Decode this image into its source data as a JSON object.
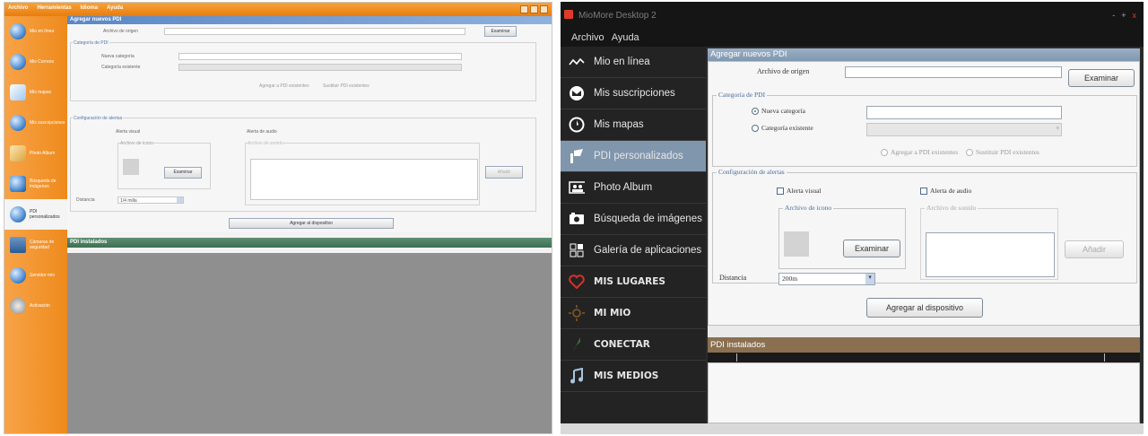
{
  "left": {
    "menu": [
      "Archivo",
      "Herramientas",
      "Idioma",
      "Ayuda"
    ],
    "sidebar": [
      {
        "label": "Mio en línea",
        "active": false
      },
      {
        "label": "Mis Correos",
        "active": false
      },
      {
        "label": "Mis mapas",
        "active": false
      },
      {
        "label": "Mis suscripciones",
        "active": false
      },
      {
        "label": "Photo Album",
        "active": false
      },
      {
        "label": "Búsqueda de imágenes",
        "active": false
      },
      {
        "label": "PDI personalizados",
        "active": true
      },
      {
        "label": "Cámaras de seguridad",
        "active": false
      },
      {
        "label": "Servidor mio",
        "active": false
      },
      {
        "label": "Activación",
        "active": false
      }
    ],
    "panel_title": "Agregar nuevos PDI",
    "source_file_label": "Archivo de origen",
    "browse_label": "Examinar",
    "category_group": "Categoría de PDI",
    "new_category": "Nueva categoría",
    "existing_category": "Categoría existente",
    "add_existing": "Agregar a PDI existentes",
    "replace_existing": "Sustituir PDI existentes",
    "alert_group": "Configuración de alertas",
    "visual_alert": "Alerta visual",
    "audio_alert": "Alerta de audio",
    "icon_file": "Archivo de icono",
    "sound_file": "Archivo de sonido",
    "add_label": "Añadir",
    "distance_label": "Distancia",
    "distance_value": "1/4 milla",
    "add_to_device": "Agregar al dispositivo",
    "installed_title": "PDI instalados"
  },
  "right": {
    "app_title": "MioMore Desktop 2",
    "window_controls": [
      "-",
      "+",
      "x"
    ],
    "menu": [
      "Archivo",
      "Ayuda"
    ],
    "sidebar": [
      {
        "label": "Mio en línea",
        "icon": "wave-icon",
        "bold": false,
        "active": false
      },
      {
        "label": "Mis suscripciones",
        "icon": "envelope-icon",
        "bold": false,
        "active": false
      },
      {
        "label": "Mis mapas",
        "icon": "compass-icon",
        "bold": false,
        "active": false
      },
      {
        "label": "PDI personalizados",
        "icon": "flag-icon",
        "bold": false,
        "active": true
      },
      {
        "label": "Photo Album",
        "icon": "photo-album-icon",
        "bold": false,
        "active": false
      },
      {
        "label": "Búsqueda de imágenes",
        "icon": "camera-icon",
        "bold": false,
        "active": false
      },
      {
        "label": "Galería de aplicaciones",
        "icon": "app-grid-icon",
        "bold": false,
        "active": false
      },
      {
        "label": "MIS LUGARES",
        "icon": "heart-icon",
        "bold": true,
        "active": false
      },
      {
        "label": "MI MIO",
        "icon": "sun-icon",
        "bold": true,
        "active": false
      },
      {
        "label": "CONECTAR",
        "icon": "connect-icon",
        "bold": true,
        "active": false
      },
      {
        "label": "MIS MEDIOS",
        "icon": "music-icon",
        "bold": true,
        "active": false
      }
    ],
    "panel_title": "Agregar nuevos PDI",
    "source_file_label": "Archivo de origen",
    "browse_label": "Examinar",
    "category_group": "Categoría de PDI",
    "new_category": "Nueva categoría",
    "existing_category": "Categoría existente",
    "add_existing": "Agregar a PDI existentes",
    "replace_existing": "Sustituir PDI existentes",
    "alert_group": "Configuración de alertas",
    "visual_alert": "Alerta visual",
    "audio_alert": "Alerta de audio",
    "icon_file": "Archivo de icono",
    "sound_file": "Archivo de sonido",
    "browse2_label": "Examinar",
    "add_label": "Añadir",
    "distance_label": "Distancia",
    "distance_value": "200m",
    "add_to_device": "Agregar al dispositivo",
    "installed_title": "PDI instalados"
  },
  "colors": {
    "left_accent": "#ee8a1c",
    "right_sidebar_active": "#8096ad",
    "right_installed_head": "#8a7051",
    "close_red": "#e03a2a"
  }
}
